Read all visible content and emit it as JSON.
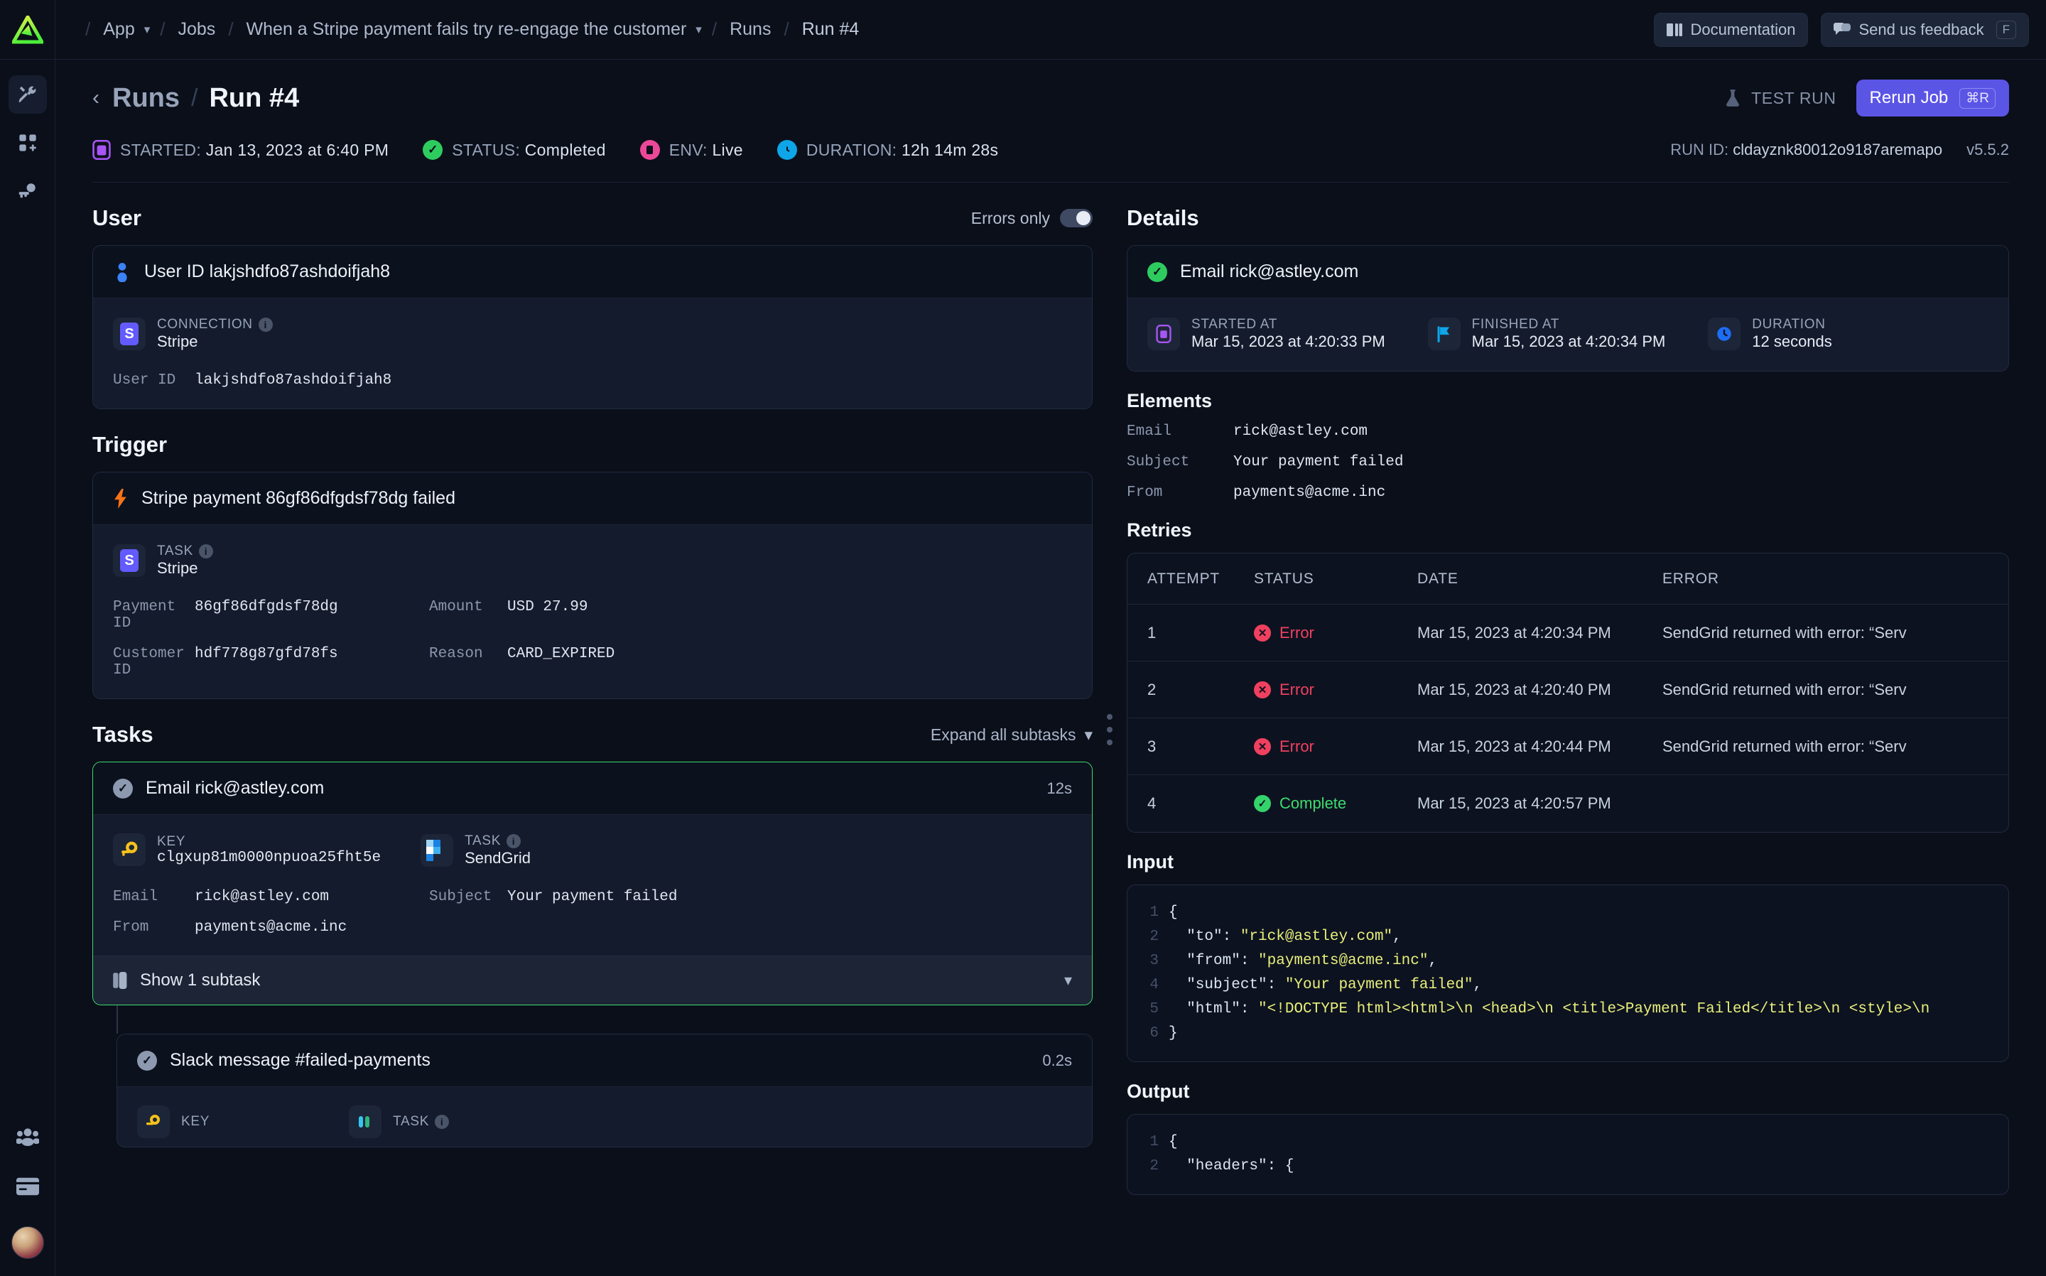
{
  "topbar": {
    "logo": "triangle-logo",
    "breadcrumbs": [
      {
        "label": "App",
        "has_chevron": true
      },
      {
        "label": "Jobs",
        "has_chevron": false
      },
      {
        "label": "When a Stripe payment fails try re-engage the customer",
        "has_chevron": true
      },
      {
        "label": "Runs",
        "has_chevron": false
      },
      {
        "label": "Run #4",
        "has_chevron": false
      }
    ],
    "documentation_label": "Documentation",
    "feedback_label": "Send us feedback",
    "feedback_kbd": "F"
  },
  "sidebar": {
    "items": [
      {
        "name": "tools-icon",
        "active": true
      },
      {
        "name": "add-module-icon",
        "active": false
      },
      {
        "name": "key-icon",
        "active": false
      }
    ],
    "bottom_items": [
      {
        "name": "team-icon"
      },
      {
        "name": "billing-icon"
      },
      {
        "name": "avatar"
      }
    ]
  },
  "page": {
    "back_label": "Runs",
    "separator": "/",
    "title": "Run #4",
    "test_run_label": "TEST RUN",
    "rerun_label": "Rerun Job",
    "rerun_kbd": "⌘R",
    "meta": [
      {
        "icon": "calendar-icon",
        "label": "STARTED:",
        "value": "Jan 13, 2023 at 6:40 PM",
        "color": "#a855f7"
      },
      {
        "icon": "check-circle-icon",
        "label": "STATUS:",
        "value": "Completed",
        "color": "#34d46b"
      },
      {
        "icon": "env-icon",
        "label": "ENV:",
        "value": "Live",
        "color": "#ec4899"
      },
      {
        "icon": "clock-icon",
        "label": "DURATION:",
        "value": "12h 14m 28s",
        "color": "#0ea5e9"
      }
    ],
    "run_id_label": "RUN ID:",
    "run_id": "cldayznk80012o9187aremapo",
    "version": "v5.5.2"
  },
  "left": {
    "user_section_title": "User",
    "errors_only_label": "Errors only",
    "errors_only_on": false,
    "user_card": {
      "header_icon": "person-icon",
      "header_title": "User ID lakjshdfo87ashdoifjah8",
      "chip": {
        "icon": "stripe-icon",
        "label": "CONNECTION",
        "value": "Stripe"
      },
      "fields": [
        {
          "key": "User ID",
          "value": "lakjshdfo87ashdoifjah8"
        }
      ]
    },
    "trigger_section_title": "Trigger",
    "trigger_card": {
      "header_icon": "lightning-icon",
      "header_title": "Stripe payment 86gf86dfgdsf78dg failed",
      "chip": {
        "icon": "stripe-icon",
        "label": "TASK",
        "value": "Stripe"
      },
      "fields": [
        {
          "key": "Payment ID",
          "value": "86gf86dfgdsf78dg",
          "key2": "Amount",
          "value2": "USD 27.99"
        },
        {
          "key": "Customer ID",
          "value": "hdf778g87gfd78fs",
          "key2": "Reason",
          "value2": "CARD_EXPIRED"
        }
      ]
    },
    "tasks_section_title": "Tasks",
    "expand_all_label": "Expand all subtasks",
    "task_card": {
      "header_title": "Email rick@astley.com",
      "duration": "12s",
      "chips": [
        {
          "icon": "key-icon",
          "label": "KEY",
          "value": "clgxup81m0000npuoa25fht5e"
        },
        {
          "icon": "sendgrid-icon",
          "label": "TASK",
          "value": "SendGrid",
          "info": true
        }
      ],
      "fields": [
        {
          "key": "Email",
          "value": "rick@astley.com",
          "key2": "Subject",
          "value2": "Your payment failed"
        },
        {
          "key": "From",
          "value": "payments@acme.inc",
          "key2": "",
          "value2": ""
        }
      ],
      "subtask_toggle_label": "Show 1 subtask"
    },
    "subtask_card": {
      "header_title": "Slack message #failed-payments",
      "duration": "0.2s",
      "chips": [
        {
          "icon": "key-icon",
          "label": "KEY"
        },
        {
          "icon": "slack-icon",
          "label": "TASK",
          "info": true
        }
      ]
    }
  },
  "right": {
    "details_title": "Details",
    "detail_card": {
      "header_title": "Email rick@astley.com",
      "meta": [
        {
          "icon": "calendar-icon",
          "label": "STARTED AT",
          "value": "Mar 15, 2023 at 4:20:33 PM"
        },
        {
          "icon": "flag-icon",
          "label": "FINISHED AT",
          "value": "Mar 15, 2023 at 4:20:34 PM"
        },
        {
          "icon": "clock-icon",
          "label": "DURATION",
          "value": "12 seconds"
        }
      ]
    },
    "elements_title": "Elements",
    "elements": [
      {
        "key": "Email",
        "value": "rick@astley.com"
      },
      {
        "key": "Subject",
        "value": "Your payment failed"
      },
      {
        "key": "From",
        "value": "payments@acme.inc"
      }
    ],
    "retries_title": "Retries",
    "retries_columns": [
      "ATTEMPT",
      "STATUS",
      "DATE",
      "ERROR"
    ],
    "retries": [
      {
        "attempt": "1",
        "status": "Error",
        "status_kind": "err",
        "date": "Mar 15, 2023 at 4:20:34 PM",
        "error": "SendGrid returned with error: “Serv"
      },
      {
        "attempt": "2",
        "status": "Error",
        "status_kind": "err",
        "date": "Mar 15, 2023 at 4:20:40 PM",
        "error": "SendGrid returned with error: “Serv"
      },
      {
        "attempt": "3",
        "status": "Error",
        "status_kind": "err",
        "date": "Mar 15, 2023 at 4:20:44 PM",
        "error": "SendGrid returned with error: “Serv"
      },
      {
        "attempt": "4",
        "status": "Complete",
        "status_kind": "ok",
        "date": "Mar 15, 2023 at 4:20:57 PM",
        "error": ""
      }
    ],
    "input_title": "Input",
    "input_lines": [
      {
        "n": "1",
        "key": "",
        "text": "{"
      },
      {
        "n": "2",
        "key": "  \"to\": ",
        "val": "\"rick@astley.com\"",
        "tail": ","
      },
      {
        "n": "3",
        "key": "  \"from\": ",
        "val": "\"payments@acme.inc\"",
        "tail": ","
      },
      {
        "n": "4",
        "key": "  \"subject\": ",
        "val": "\"Your payment failed\"",
        "tail": ","
      },
      {
        "n": "5",
        "key": "  \"html\": ",
        "val": "\"<!DOCTYPE html><html>\\n <head>\\n <title>Payment Failed</title>\\n <style>\\n",
        "tail": ""
      },
      {
        "n": "6",
        "key": "",
        "text": "}"
      }
    ],
    "output_title": "Output",
    "output_lines": [
      {
        "n": "1",
        "key": "",
        "text": "{"
      },
      {
        "n": "2",
        "key": "  \"headers\": {",
        "val": "",
        "tail": ""
      }
    ]
  },
  "colors": {
    "accent": "#5b55e6",
    "success": "#34d46b",
    "error": "#f0405f",
    "logo_green": "#58e648",
    "highlight_border": "#3ddc6e"
  }
}
